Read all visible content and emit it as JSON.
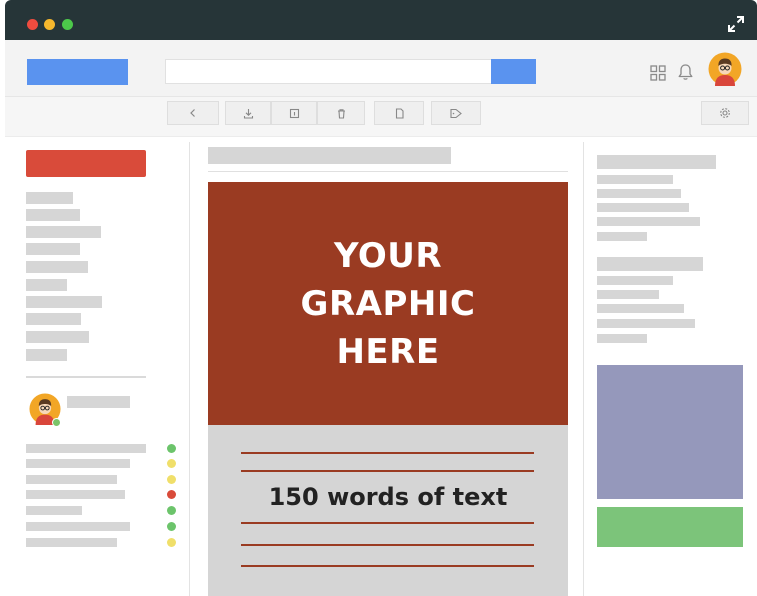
{
  "window": {
    "controls": [
      "close",
      "minimize",
      "maximize"
    ],
    "expand_icon": "expand-icon"
  },
  "appbar": {
    "search": {
      "placeholder": "",
      "value": ""
    },
    "icons": [
      "apps-grid-icon",
      "bell-icon",
      "user-avatar"
    ]
  },
  "toolbar": {
    "icons": [
      "back-icon",
      "download-icon",
      "info-icon",
      "delete-icon",
      "document-icon",
      "tag-icon",
      "settings-icon"
    ]
  },
  "content": {
    "graphic_text": "YOUR GRAPHIC HERE",
    "body_text": "150 words of text"
  },
  "sidebar": {
    "status_colors": [
      "#6cc46b",
      "#f0df6a",
      "#f0df6a",
      "#d94b3a",
      "#6cc46b",
      "#6cc46b",
      "#f0df6a"
    ]
  },
  "colors": {
    "accent_blue": "#5a93ef",
    "compose_red": "#d94b3a",
    "graphic_brown": "#9a3b22",
    "ad_purple": "#9598bb",
    "ad_green": "#7cc47a"
  }
}
